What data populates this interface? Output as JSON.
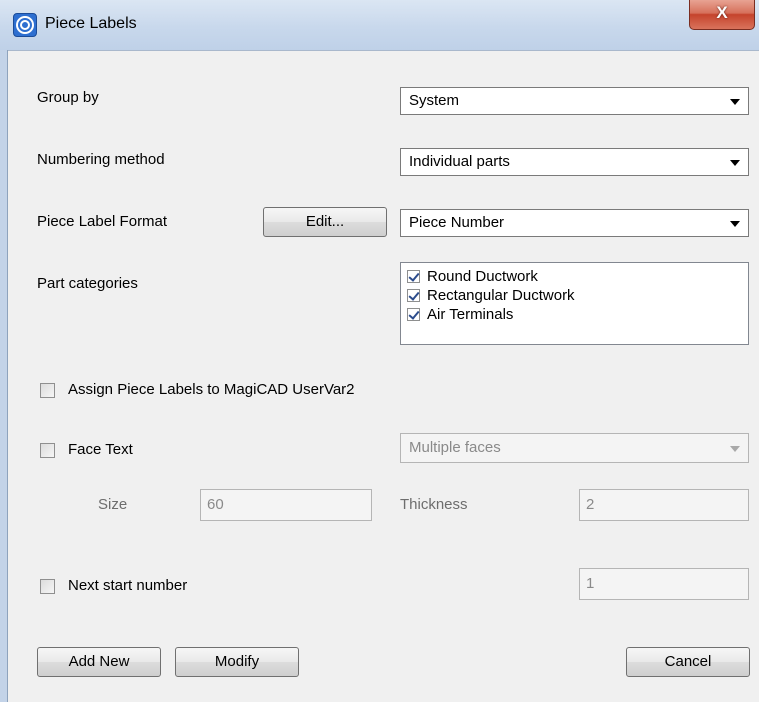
{
  "window": {
    "title": "Piece Labels",
    "close_glyph": "X",
    "icon": "magicad-app-icon"
  },
  "form": {
    "group_by_label": "Group by",
    "group_by_value": "System",
    "numbering_label": "Numbering method",
    "numbering_value": "Individual parts",
    "format_label": "Piece Label Format",
    "edit_button": "Edit...",
    "format_value": "Piece Number",
    "categories_label": "Part categories",
    "categories": [
      {
        "label": "Round Ductwork",
        "checked": true
      },
      {
        "label": "Rectangular Ductwork",
        "checked": true
      },
      {
        "label": "Air Terminals",
        "checked": true
      }
    ],
    "assign_label": "Assign Piece Labels to MagiCAD UserVar2",
    "assign_checked": false,
    "face_text_label": "Face Text",
    "face_text_checked": false,
    "face_mode_value": "Multiple faces",
    "size_label": "Size",
    "size_value": "60",
    "thickness_label": "Thickness",
    "thickness_value": "2",
    "next_start_label": "Next start number",
    "next_start_checked": false,
    "next_start_value": "1"
  },
  "buttons": {
    "add_new": "Add New",
    "modify": "Modify",
    "cancel": "Cancel"
  }
}
